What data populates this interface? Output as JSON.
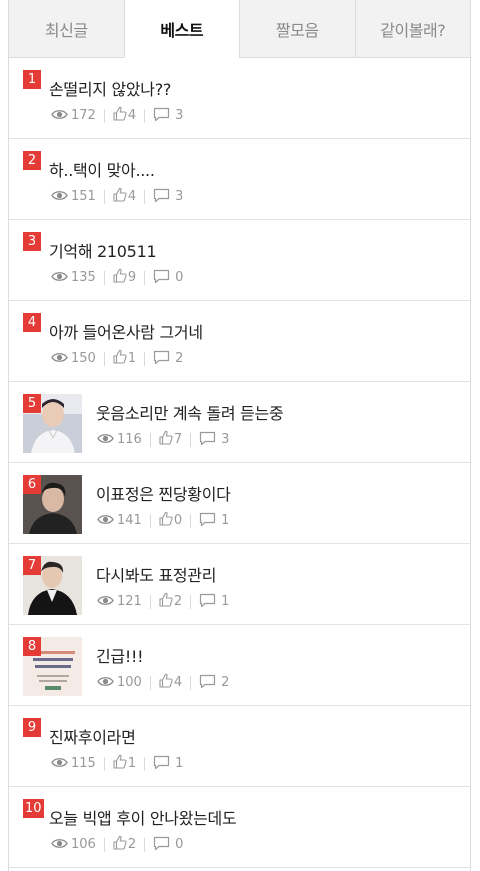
{
  "tabs": [
    {
      "label": "최신글",
      "active": false
    },
    {
      "label": "베스트",
      "active": true
    },
    {
      "label": "짤모음",
      "active": false
    },
    {
      "label": "같이볼래?",
      "active": false
    }
  ],
  "colors": {
    "rank_bg": "#e53b36",
    "meta_text": "#999999"
  },
  "posts": [
    {
      "rank": "1",
      "title": "손떨리지 않았나??",
      "views": "172",
      "likes": "4",
      "comments": "3",
      "thumb": null
    },
    {
      "rank": "2",
      "title": "하..택이 맞아....",
      "views": "151",
      "likes": "4",
      "comments": "3",
      "thumb": null
    },
    {
      "rank": "3",
      "title": "기억해 210511",
      "views": "135",
      "likes": "9",
      "comments": "0",
      "thumb": null
    },
    {
      "rank": "4",
      "title": "아까 들어온사람 그거네",
      "views": "150",
      "likes": "1",
      "comments": "2",
      "thumb": null
    },
    {
      "rank": "5",
      "title": "웃음소리만 계속 돌려 듣는중",
      "views": "116",
      "likes": "7",
      "comments": "3",
      "thumb": "photo-white-shirt"
    },
    {
      "rank": "6",
      "title": "이표정은 찐당황이다",
      "views": "141",
      "likes": "0",
      "comments": "1",
      "thumb": "photo-dark"
    },
    {
      "rank": "7",
      "title": "다시봐도 표정관리",
      "views": "121",
      "likes": "2",
      "comments": "1",
      "thumb": "photo-leather"
    },
    {
      "rank": "8",
      "title": "긴급!!!",
      "views": "100",
      "likes": "4",
      "comments": "2",
      "thumb": "poster-award"
    },
    {
      "rank": "9",
      "title": "진짜후이라면",
      "views": "115",
      "likes": "1",
      "comments": "1",
      "thumb": null
    },
    {
      "rank": "10",
      "title": "오늘 빅앱 후이 안나왔는데도",
      "views": "106",
      "likes": "2",
      "comments": "0",
      "thumb": null
    }
  ]
}
